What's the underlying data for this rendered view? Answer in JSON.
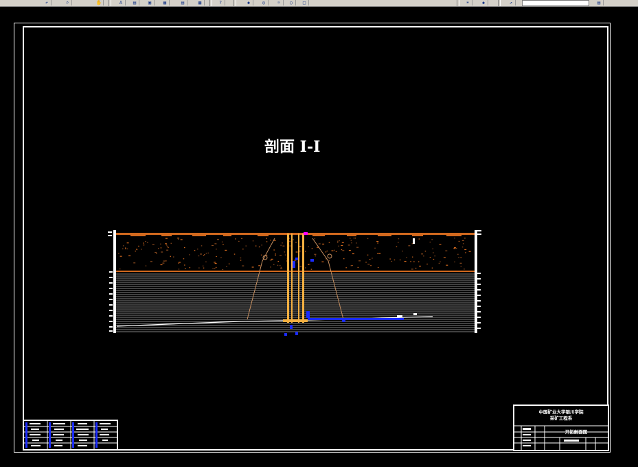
{
  "drawing": {
    "title": "剖面  I-I"
  },
  "title_block": {
    "school": "中国矿业大学银川学院",
    "department": "采矿工程系",
    "drawing_name": "开拓剖面图"
  },
  "colors": {
    "background": "#000000",
    "frame": "#ffffff",
    "topsoil_line": "#d2691e",
    "shaft": "#f5b041",
    "water_marker": "#1a2bff",
    "highlight": "#ff00ff",
    "strata_lines": "#ffffff"
  },
  "toolbar": {
    "icons": [
      "undo-icon",
      "zoom-icon",
      "pan-icon",
      "properties-icon",
      "layer-icon",
      "print-icon",
      "snap-icon",
      "help-icon"
    ]
  }
}
